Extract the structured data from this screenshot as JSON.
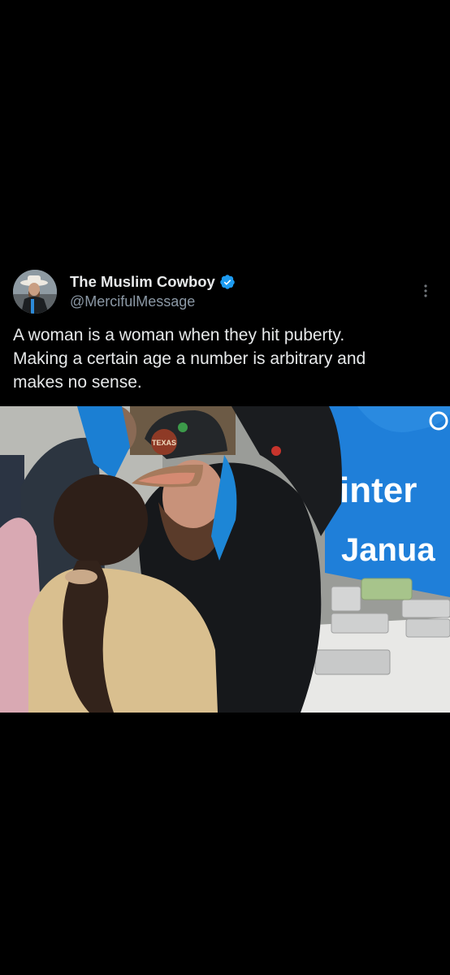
{
  "tweet": {
    "author": {
      "display_name": "The Muslim Cowboy",
      "handle": "@MercifulMessage",
      "verified": true
    },
    "text_lines": [
      "A woman is a woman when they hit puberty.",
      "Making a certain age a number is arbitrary and",
      "makes no sense."
    ],
    "media": {
      "banner_line1": "inter",
      "banner_line2": "Janua",
      "cap_patch": "TEXAS"
    }
  },
  "colors": {
    "background": "#000000",
    "text_primary": "#e7e9ea",
    "text_secondary": "#8b98a5",
    "verified_blue": "#1d9bf0",
    "banner_blue": "#1f7fd9"
  },
  "icons": {
    "verified": "verified-badge-icon",
    "more": "more-vertical-icon"
  }
}
